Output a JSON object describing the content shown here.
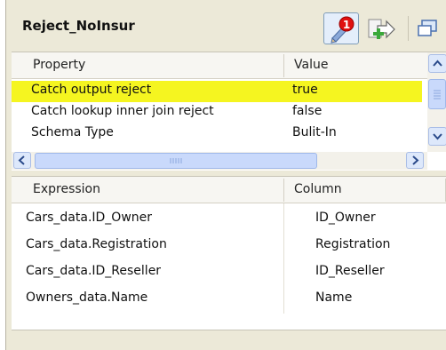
{
  "panel": {
    "title": "Reject_NoInsur",
    "error_count": "1"
  },
  "property_table": {
    "headers": [
      "Property",
      "Value"
    ],
    "rows": [
      {
        "property": "Catch output reject",
        "value": "true",
        "selected": true
      },
      {
        "property": "Catch lookup inner join reject",
        "value": "false",
        "selected": false
      },
      {
        "property": "Schema Type",
        "value": "Bulit-In",
        "selected": false
      }
    ]
  },
  "expression_table": {
    "headers": [
      "Expression",
      "Column"
    ],
    "rows": [
      {
        "expression": "Cars_data.ID_Owner",
        "column": "ID_Owner"
      },
      {
        "expression": "Cars_data.Registration",
        "column": "Registration"
      },
      {
        "expression": "Cars_data.ID_Reseller",
        "column": "ID_Reseller"
      },
      {
        "expression": "Owners_data.Name",
        "column": "Name"
      }
    ]
  },
  "colors": {
    "selected_row": "#f5f520",
    "error_badge": "#e01010",
    "panel_bg": "#ece9d8"
  },
  "icons": [
    "error-badge-icon",
    "pen-icon",
    "export-arrow-icon",
    "restore-window-icon",
    "scroll-up-icon",
    "scroll-down-icon",
    "scroll-left-icon",
    "scroll-right-icon"
  ]
}
